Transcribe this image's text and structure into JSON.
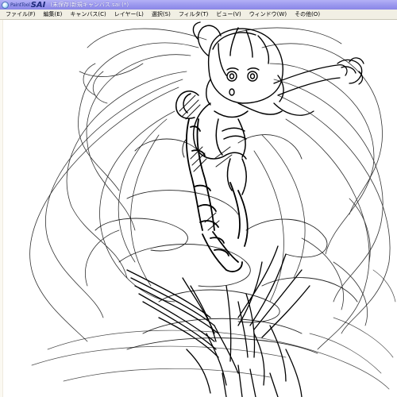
{
  "window": {
    "logo_small": "PaintTool",
    "logo_big": "SAI",
    "title": "(未保存)新規キャンバス.sai (*)"
  },
  "menu": {
    "items": [
      {
        "label": "ファイル(F)"
      },
      {
        "label": "編集(E)"
      },
      {
        "label": "キャンバス(C)"
      },
      {
        "label": "レイヤー(L)"
      },
      {
        "label": "選択(S)"
      },
      {
        "label": "フィルタ(T)"
      },
      {
        "label": "ビュー(V)"
      },
      {
        "label": "ウィンドウ(W)"
      },
      {
        "label": "その他(O)"
      }
    ]
  },
  "canvas": {
    "content": "rough pencil sketch of a character",
    "stroke_color": "#000000",
    "background_color": "#ffffff"
  },
  "colors": {
    "titlebar": "#9a97ee",
    "menubar": "#f1efe4"
  }
}
